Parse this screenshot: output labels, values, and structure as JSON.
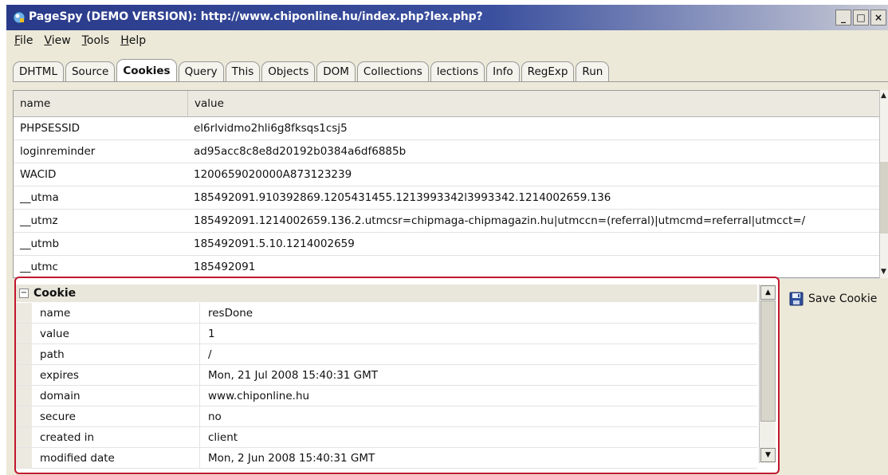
{
  "window": {
    "title": "PageSpy (DEMO VERSION): http://www.chiponline.hu/index.php?lex.php?",
    "controls": {
      "minimize": "_",
      "maximize": "□",
      "close": "×"
    }
  },
  "menu": [
    "File",
    "View",
    "Tools",
    "Help"
  ],
  "tabs": [
    {
      "label": "DHTML",
      "active": false
    },
    {
      "label": "Source",
      "active": false
    },
    {
      "label": "Cookies",
      "active": true
    },
    {
      "label": "Query",
      "active": false
    },
    {
      "label": "This",
      "active": false
    },
    {
      "label": "Objects",
      "active": false
    },
    {
      "label": "DOM",
      "active": false
    },
    {
      "label": "Collections",
      "active": false
    },
    {
      "label": "lections",
      "active": false
    },
    {
      "label": "Info",
      "active": false
    },
    {
      "label": "RegExp",
      "active": false
    },
    {
      "label": "Run",
      "active": false
    }
  ],
  "table": {
    "headers": {
      "name": "name",
      "value": "value"
    },
    "rows": [
      {
        "name": "PHPSESSID",
        "value": "el6rlvidmo2hli6g8fksqs1csj5"
      },
      {
        "name": "loginreminder",
        "value": "ad95acc8c8e8d20192b0384a6df6885b"
      },
      {
        "name": "WACID",
        "value": "1200659020000A873123239"
      },
      {
        "name": "__utma",
        "value": "185492091.910392869.1205431455.1213993342l3993342.1214002659.136"
      },
      {
        "name": "__utmz",
        "value": "185492091.1214002659.136.2.utmcsr=chipmaga-chipmagazin.hu|utmccn=(referral)|utmcmd=referral|utmcct=/"
      },
      {
        "name": "__utmb",
        "value": "185492091.5.10.1214002659"
      },
      {
        "name": "__utmc",
        "value": "185492091"
      }
    ]
  },
  "cookie_panel": {
    "title": "Cookie",
    "collapse_glyph": "−",
    "properties": [
      {
        "name": "name",
        "value": "resDone"
      },
      {
        "name": "value",
        "value": "1"
      },
      {
        "name": "path",
        "value": "/"
      },
      {
        "name": "expires",
        "value": "Mon, 21 Jul 2008 15:40:31 GMT"
      },
      {
        "name": "domain",
        "value": "www.chiponline.hu"
      },
      {
        "name": "secure",
        "value": "no"
      },
      {
        "name": "created in",
        "value": "client"
      },
      {
        "name": "modified date",
        "value": "Mon, 2 Jun 2008 15:40:31 GMT"
      }
    ]
  },
  "save_button": {
    "label": "Save Cookie"
  },
  "colors": {
    "highlight_border": "#c2162d",
    "titlebar": "#2a3a8a"
  }
}
